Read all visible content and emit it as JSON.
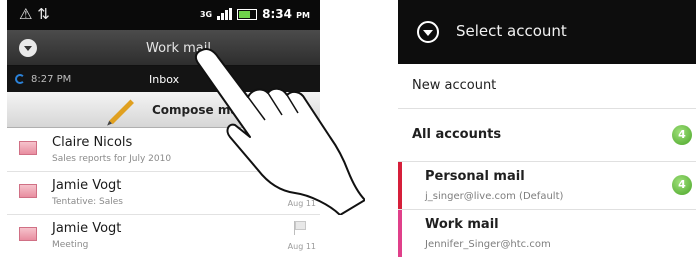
{
  "left_screen": {
    "status_bar": {
      "time": "8:34",
      "ampm": "PM",
      "network": "3G"
    },
    "title": "Work mail",
    "sub_bar": {
      "time": "8:27 PM",
      "folder": "Inbox"
    },
    "compose_label": "Compose mail",
    "mails": [
      {
        "sender": "Claire Nicols",
        "subject": "Sales reports for July 2010",
        "date": ""
      },
      {
        "sender": "Jamie Vogt",
        "subject": "Tentative: Sales",
        "date": "Aug 11"
      },
      {
        "sender": "Jamie Vogt",
        "subject": "Meeting",
        "date": "Aug 11"
      }
    ]
  },
  "right_screen": {
    "title": "Select account",
    "new_account": "New account",
    "all_accounts": {
      "label": "All accounts",
      "count": "4"
    },
    "accounts": [
      {
        "name": "Personal mail",
        "email": "j_singer@live.com (Default)",
        "count": "4",
        "stripe_color": "#d61f3a"
      },
      {
        "name": "Work mail",
        "email": "Jennifer_Singer@htc.com",
        "count": "",
        "stripe_color": "#e0408a"
      }
    ]
  },
  "colors": {
    "badge_green": "#4aa628",
    "accent_blue": "#2b82d9"
  }
}
